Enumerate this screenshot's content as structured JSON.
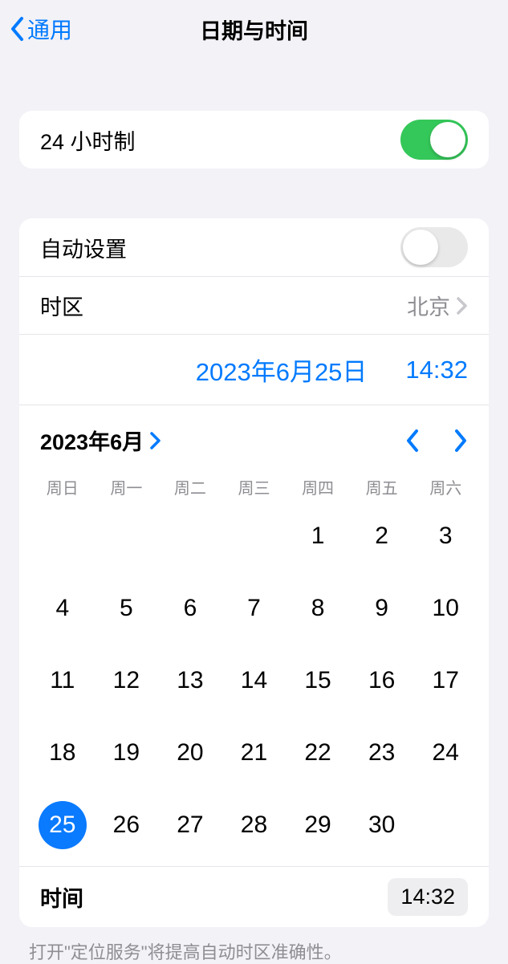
{
  "header": {
    "back_label": "通用",
    "title": "日期与时间"
  },
  "twenty_four_hour": {
    "label": "24 小时制",
    "enabled": true
  },
  "auto_set": {
    "label": "自动设置",
    "enabled": false
  },
  "timezone": {
    "label": "时区",
    "value": "北京"
  },
  "selected": {
    "date_display": "2023年6月25日",
    "time_display": "14:32"
  },
  "calendar": {
    "month_label": "2023年6月",
    "weekdays": [
      "周日",
      "周一",
      "周二",
      "周三",
      "周四",
      "周五",
      "周六"
    ],
    "leading_blanks": 4,
    "days": [
      1,
      2,
      3,
      4,
      5,
      6,
      7,
      8,
      9,
      10,
      11,
      12,
      13,
      14,
      15,
      16,
      17,
      18,
      19,
      20,
      21,
      22,
      23,
      24,
      25,
      26,
      27,
      28,
      29,
      30
    ],
    "selected_day": 25
  },
  "time_row": {
    "label": "时间",
    "value": "14:32"
  },
  "footer": "打开\"定位服务\"将提高自动时区准确性。"
}
